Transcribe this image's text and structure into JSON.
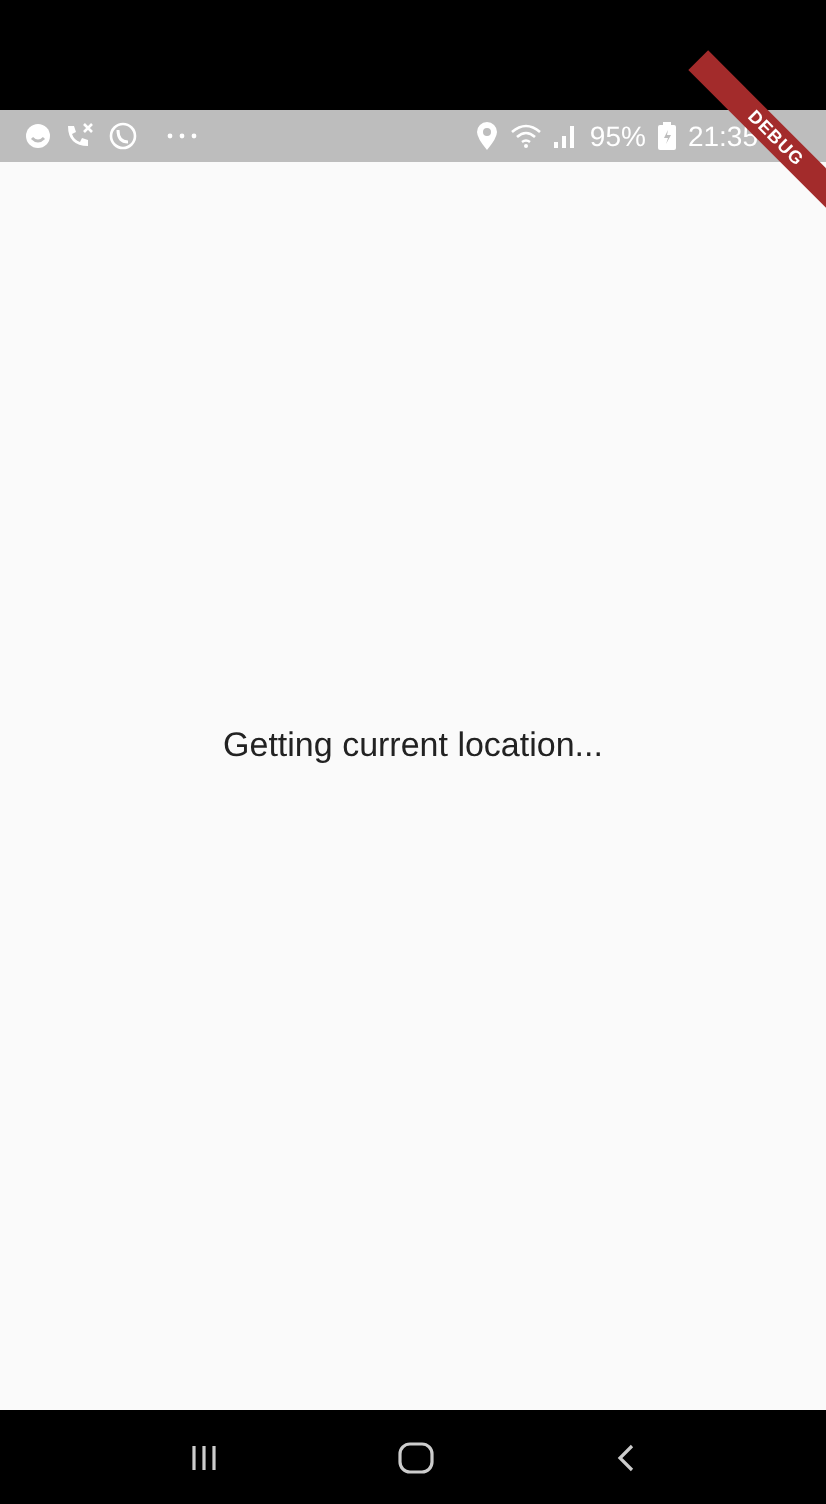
{
  "status_bar": {
    "battery": "95%",
    "time": "21:35"
  },
  "debug_banner": {
    "label": "DEBUG"
  },
  "message": "Getting current location..."
}
